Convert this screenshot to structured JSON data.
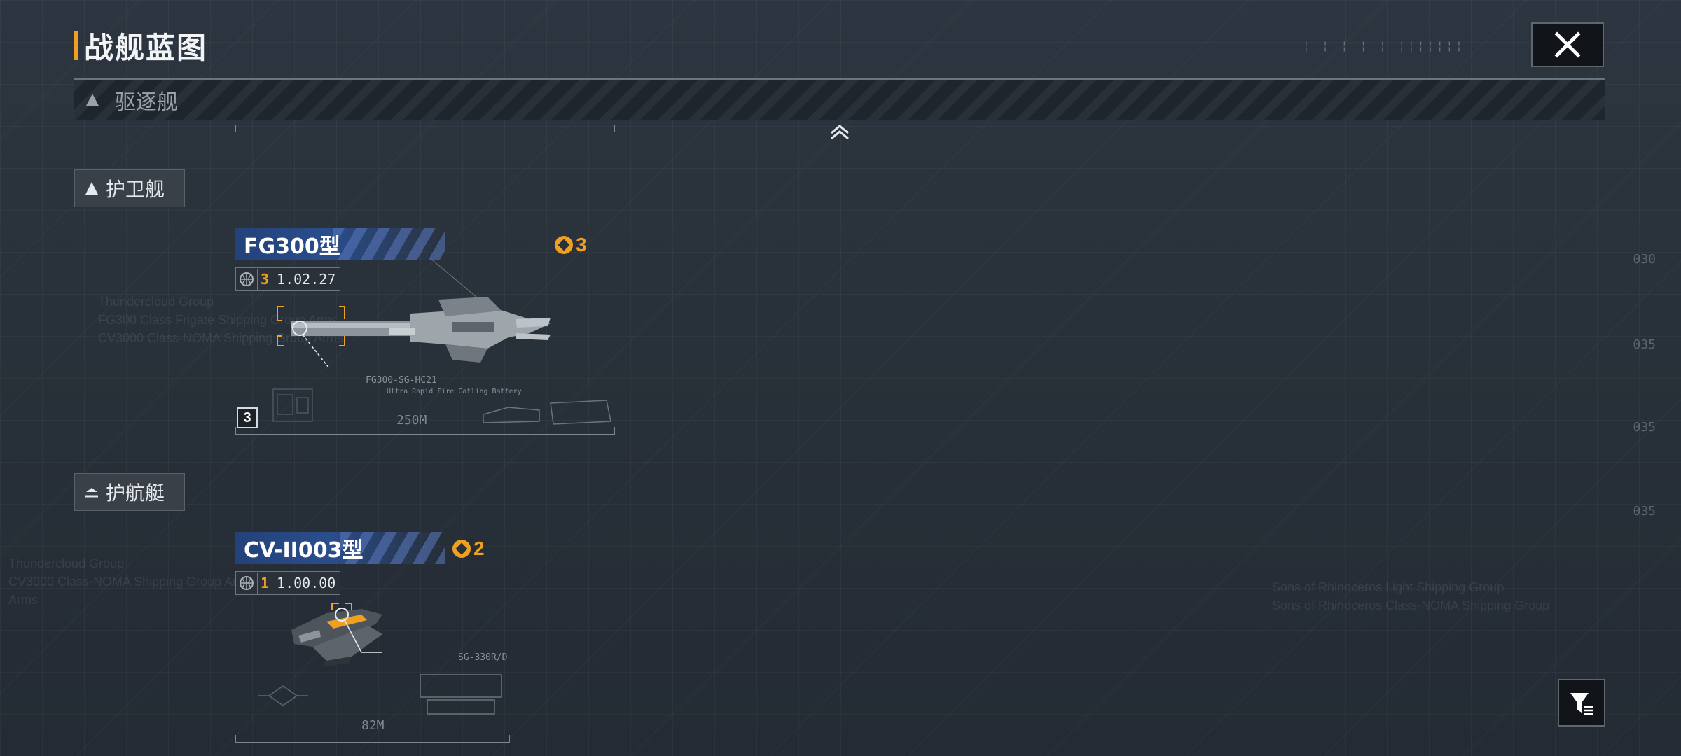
{
  "window": {
    "title": "战舰蓝图"
  },
  "colors": {
    "accent": "#f0a020",
    "name_tag": "#2a4d8c",
    "panel": "#1f252d"
  },
  "category_bar": {
    "label": "驱逐舰",
    "icon": "triangle-icon"
  },
  "sections": [
    {
      "label": "护卫舰",
      "icon": "triangle-icon"
    },
    {
      "label": "护航艇",
      "icon": "chevron-stack-icon"
    }
  ],
  "ships": [
    {
      "name": "FG300型",
      "tokens": "3",
      "count": "3",
      "version": "1.02.27",
      "weapon_code": "FG300-SG-HC21",
      "weapon_sub": "Ultra Rapid Fire Gatling Battery",
      "length": "250M",
      "level": "3"
    },
    {
      "name": "CV-II003型",
      "tokens": "2",
      "count": "1",
      "version": "1.00.00",
      "weapon_code": "SG-330R/D",
      "length": "82M"
    }
  ],
  "background_text": {
    "left_upper": "Thundercloud Group\nFG300 Class Frigate Shipping Group Arms\nCV3000 Class-NOMA Shipping Group Arms",
    "left_lower": "Thundercloud Group\nCV3000 Class-NOMA Shipping Group Arms\nArms",
    "right": "Sons of Rhinoceros Light Shipping Group\nSons of Rhinoceros Class-NOMA Shipping Group",
    "edge_nums": [
      "030",
      "035",
      "035",
      "035"
    ]
  }
}
